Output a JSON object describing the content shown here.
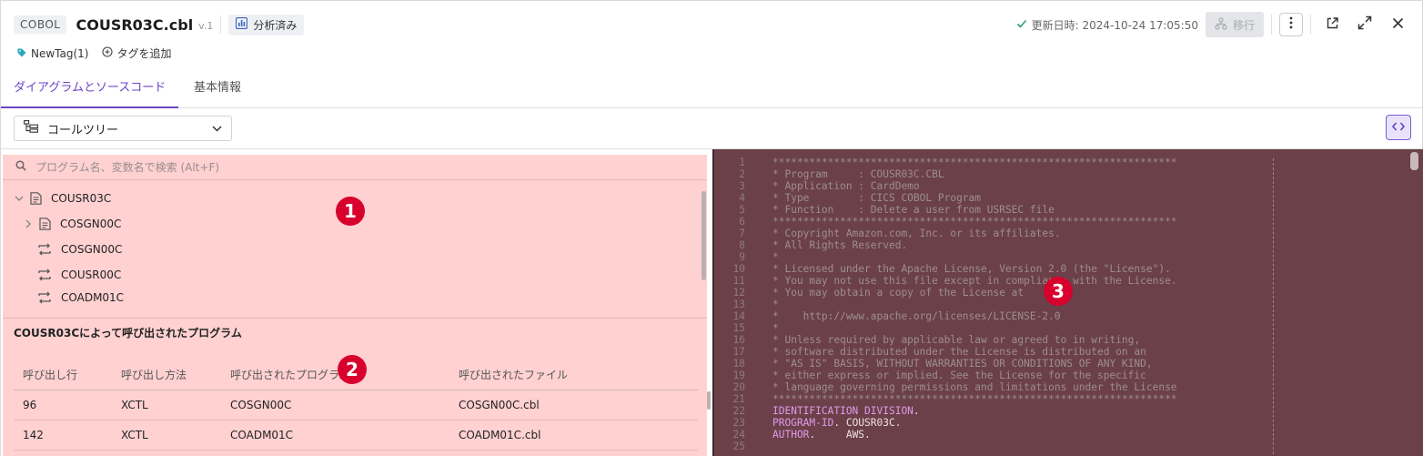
{
  "header": {
    "language_badge": "COBOL",
    "file_name": "COUSR03C.cbl",
    "version": "v.1",
    "analysis_status": "分析済み",
    "updated": "更新日時: 2024-10-24 17:05:50",
    "migrate_label": "移行"
  },
  "tags": {
    "items": [
      "NewTag(1)"
    ],
    "add_label": "タグを追加"
  },
  "tabs": [
    {
      "label": "ダイアグラムとソースコード",
      "active": true
    },
    {
      "label": "基本情報",
      "active": false
    }
  ],
  "toolbar": {
    "view_select": "コールツリー"
  },
  "tree": {
    "search_placeholder": "プログラム名、変数名で検索 (Alt+F)",
    "nodes": [
      {
        "label": "COUSR03C",
        "level": 0,
        "type": "file",
        "expanded": true
      },
      {
        "label": "COSGN00C",
        "level": 1,
        "type": "file",
        "expanded": false
      },
      {
        "label": "COSGN00C",
        "level": 1,
        "type": "xctl"
      },
      {
        "label": "COUSR00C",
        "level": 1,
        "type": "xctl"
      },
      {
        "label": "COADM01C",
        "level": 1,
        "type": "xctl"
      }
    ]
  },
  "called_programs": {
    "title": "COUSR03Cによって呼び出されたプログラム",
    "columns": [
      "呼び出し行",
      "呼び出し方法",
      "呼び出されたプログラム",
      "呼び出されたファイル"
    ],
    "rows": [
      [
        "96",
        "XCTL",
        "COSGN00C",
        "COSGN00C.cbl"
      ],
      [
        "142",
        "XCTL",
        "COADM01C",
        "COADM01C.cbl"
      ]
    ]
  },
  "markers": [
    "1",
    "2",
    "3"
  ],
  "code_lines": [
    {
      "n": "1",
      "t": "******************************************************************",
      "k": "ct"
    },
    {
      "n": "2",
      "t": "* Program     : COUSR03C.CBL",
      "k": "ct"
    },
    {
      "n": "3",
      "t": "* Application : CardDemo",
      "k": "ct"
    },
    {
      "n": "4",
      "t": "* Type        : CICS COBOL Program",
      "k": "ct"
    },
    {
      "n": "5",
      "t": "* Function    : Delete a user from USRSEC file",
      "k": "ct"
    },
    {
      "n": "6",
      "t": "******************************************************************",
      "k": "ct"
    },
    {
      "n": "7",
      "t": "* Copyright Amazon.com, Inc. or its affiliates.",
      "k": "ct"
    },
    {
      "n": "8",
      "t": "* All Rights Reserved.",
      "k": "ct"
    },
    {
      "n": "9",
      "t": "*",
      "k": "ct"
    },
    {
      "n": "10",
      "t": "* Licensed under the Apache License, Version 2.0 (the \"License\").",
      "k": "ct"
    },
    {
      "n": "11",
      "t": "* You may not use this file except in compliance with the License.",
      "k": "ct"
    },
    {
      "n": "12",
      "t": "* You may obtain a copy of the License at",
      "k": "ct"
    },
    {
      "n": "13",
      "t": "*",
      "k": "ct"
    },
    {
      "n": "14",
      "t": "*    http://www.apache.org/licenses/LICENSE-2.0",
      "k": "ct"
    },
    {
      "n": "15",
      "t": "*",
      "k": "ct"
    },
    {
      "n": "16",
      "t": "* Unless required by applicable law or agreed to in writing,",
      "k": "ct"
    },
    {
      "n": "17",
      "t": "* software distributed under the License is distributed on an",
      "k": "ct"
    },
    {
      "n": "18",
      "t": "* \"AS IS\" BASIS, WITHOUT WARRANTIES OR CONDITIONS OF ANY KIND,",
      "k": "ct"
    },
    {
      "n": "19",
      "t": "* either express or implied. See the License for the specific",
      "k": "ct"
    },
    {
      "n": "20",
      "t": "* language governing permissions and limitations under the License",
      "k": "ct"
    },
    {
      "n": "21",
      "t": "******************************************************************",
      "k": "ct"
    },
    {
      "n": "22",
      "kw": "IDENTIFICATION DIVISION",
      "rest": "."
    },
    {
      "n": "23",
      "kw": "PROGRAM-ID",
      "rest": ". COUSR03C."
    },
    {
      "n": "24",
      "kw": "AUTHOR",
      "rest": ".     AWS."
    },
    {
      "n": "25",
      "t": "",
      "k": "ct"
    }
  ]
}
